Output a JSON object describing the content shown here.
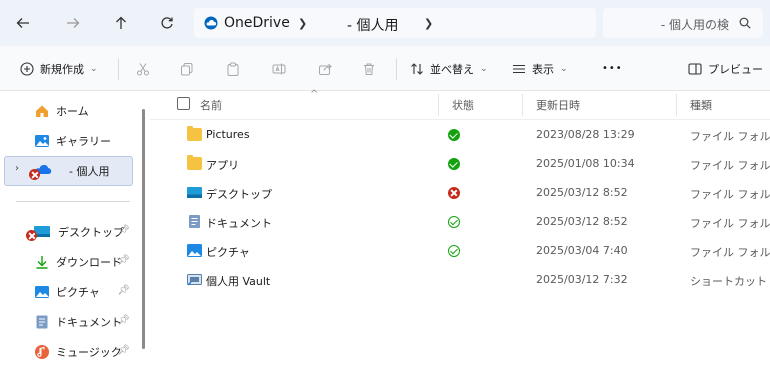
{
  "addressbar": {
    "breadcrumb": [
      "OneDrive",
      "- 個人用"
    ],
    "search_placeholder": "- 個人用の検"
  },
  "toolbar": {
    "new_label": "新規作成",
    "sort_label": "並べ替え",
    "view_label": "表示",
    "more_label": "•••",
    "preview_label": "プレビュー"
  },
  "sidebar": {
    "items": [
      {
        "label": "ホーム",
        "icon": "home-icon"
      },
      {
        "label": "ギャラリー",
        "icon": "gallery-icon"
      },
      {
        "label": "- 個人用",
        "icon": "onedrive-cloud-icon",
        "selected": true,
        "status": "error"
      },
      {
        "label": "デスクトップ",
        "icon": "desktop-folder-icon",
        "pinned": true,
        "status": "error"
      },
      {
        "label": "ダウンロード",
        "icon": "download-icon",
        "pinned": true
      },
      {
        "label": "ピクチャ",
        "icon": "pictures-icon",
        "pinned": true
      },
      {
        "label": "ドキュメント",
        "icon": "documents-icon",
        "pinned": true
      },
      {
        "label": "ミュージック",
        "icon": "music-icon",
        "pinned": true
      }
    ]
  },
  "columns": {
    "name": "名前",
    "status": "状態",
    "modified": "更新日時",
    "type": "種類"
  },
  "files": [
    {
      "name": "Pictures",
      "icon": "folder-icon",
      "status": "synced",
      "modified": "2023/08/28 13:29",
      "type": "ファイル フォルダー"
    },
    {
      "name": "アプリ",
      "icon": "folder-icon",
      "status": "synced",
      "modified": "2025/01/08 10:34",
      "type": "ファイル フォルダー"
    },
    {
      "name": "デスクトップ",
      "icon": "desktop-folder-icon",
      "status": "error",
      "modified": "2025/03/12 8:52",
      "type": "ファイル フォルダー"
    },
    {
      "name": "ドキュメント",
      "icon": "documents-icon",
      "status": "available",
      "modified": "2025/03/12 8:52",
      "type": "ファイル フォルダー"
    },
    {
      "name": "ピクチャ",
      "icon": "pictures-icon",
      "status": "available",
      "modified": "2025/03/04 7:40",
      "type": "ファイル フォルダー"
    },
    {
      "name": "個人用 Vault",
      "icon": "vault-shortcut-icon",
      "status": "",
      "modified": "2025/03/12 7:32",
      "type": "ショートカット"
    }
  ],
  "colors": {
    "accent": "#0067c0",
    "synced": "#13a10e",
    "error": "#c42b1c",
    "folder": "#f6c242",
    "selection": "#e3eaf5"
  }
}
